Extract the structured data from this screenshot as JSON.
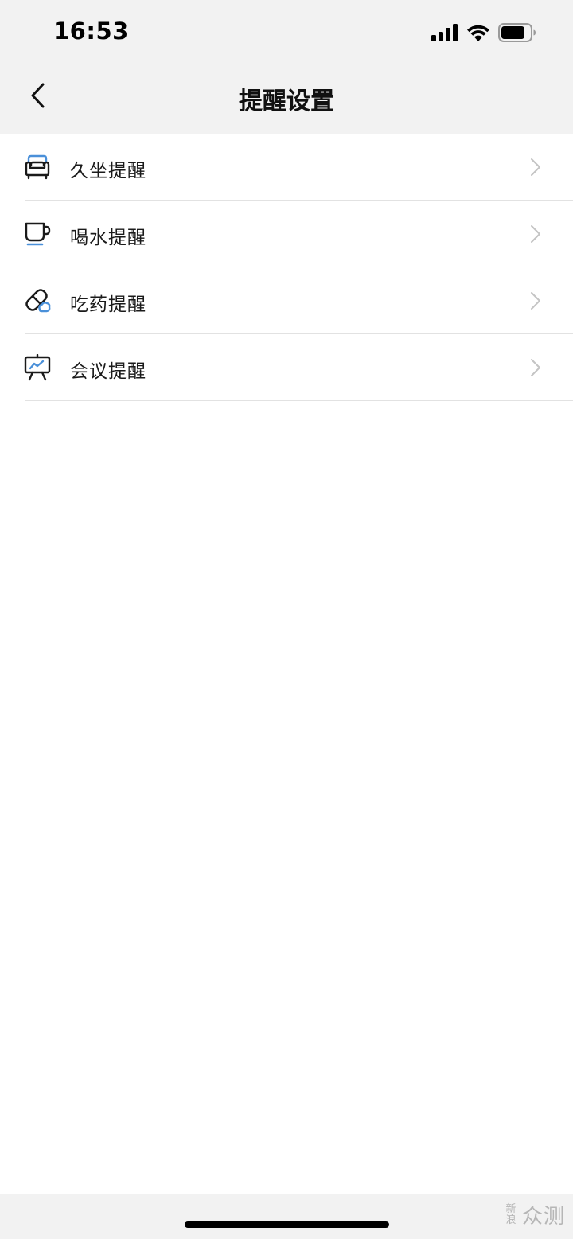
{
  "status_bar": {
    "time": "16:53",
    "icons": [
      "cellular-signal-icon",
      "wifi-icon",
      "battery-icon"
    ]
  },
  "nav": {
    "back_icon": "chevron-left-icon",
    "title": "提醒设置"
  },
  "reminders": [
    {
      "label": "久坐提醒",
      "icon": "sofa-icon"
    },
    {
      "label": "喝水提醒",
      "icon": "cup-icon"
    },
    {
      "label": "吃药提醒",
      "icon": "pill-icon"
    },
    {
      "label": "会议提醒",
      "icon": "presentation-board-icon"
    }
  ],
  "watermark": {
    "small_text": "新浪",
    "big_text": "众测"
  },
  "colors": {
    "accent_blue": "#4a90d9",
    "icon_dark": "#1a1a1a",
    "chevron": "#c4c4c4",
    "header_bg": "#f2f2f2"
  }
}
